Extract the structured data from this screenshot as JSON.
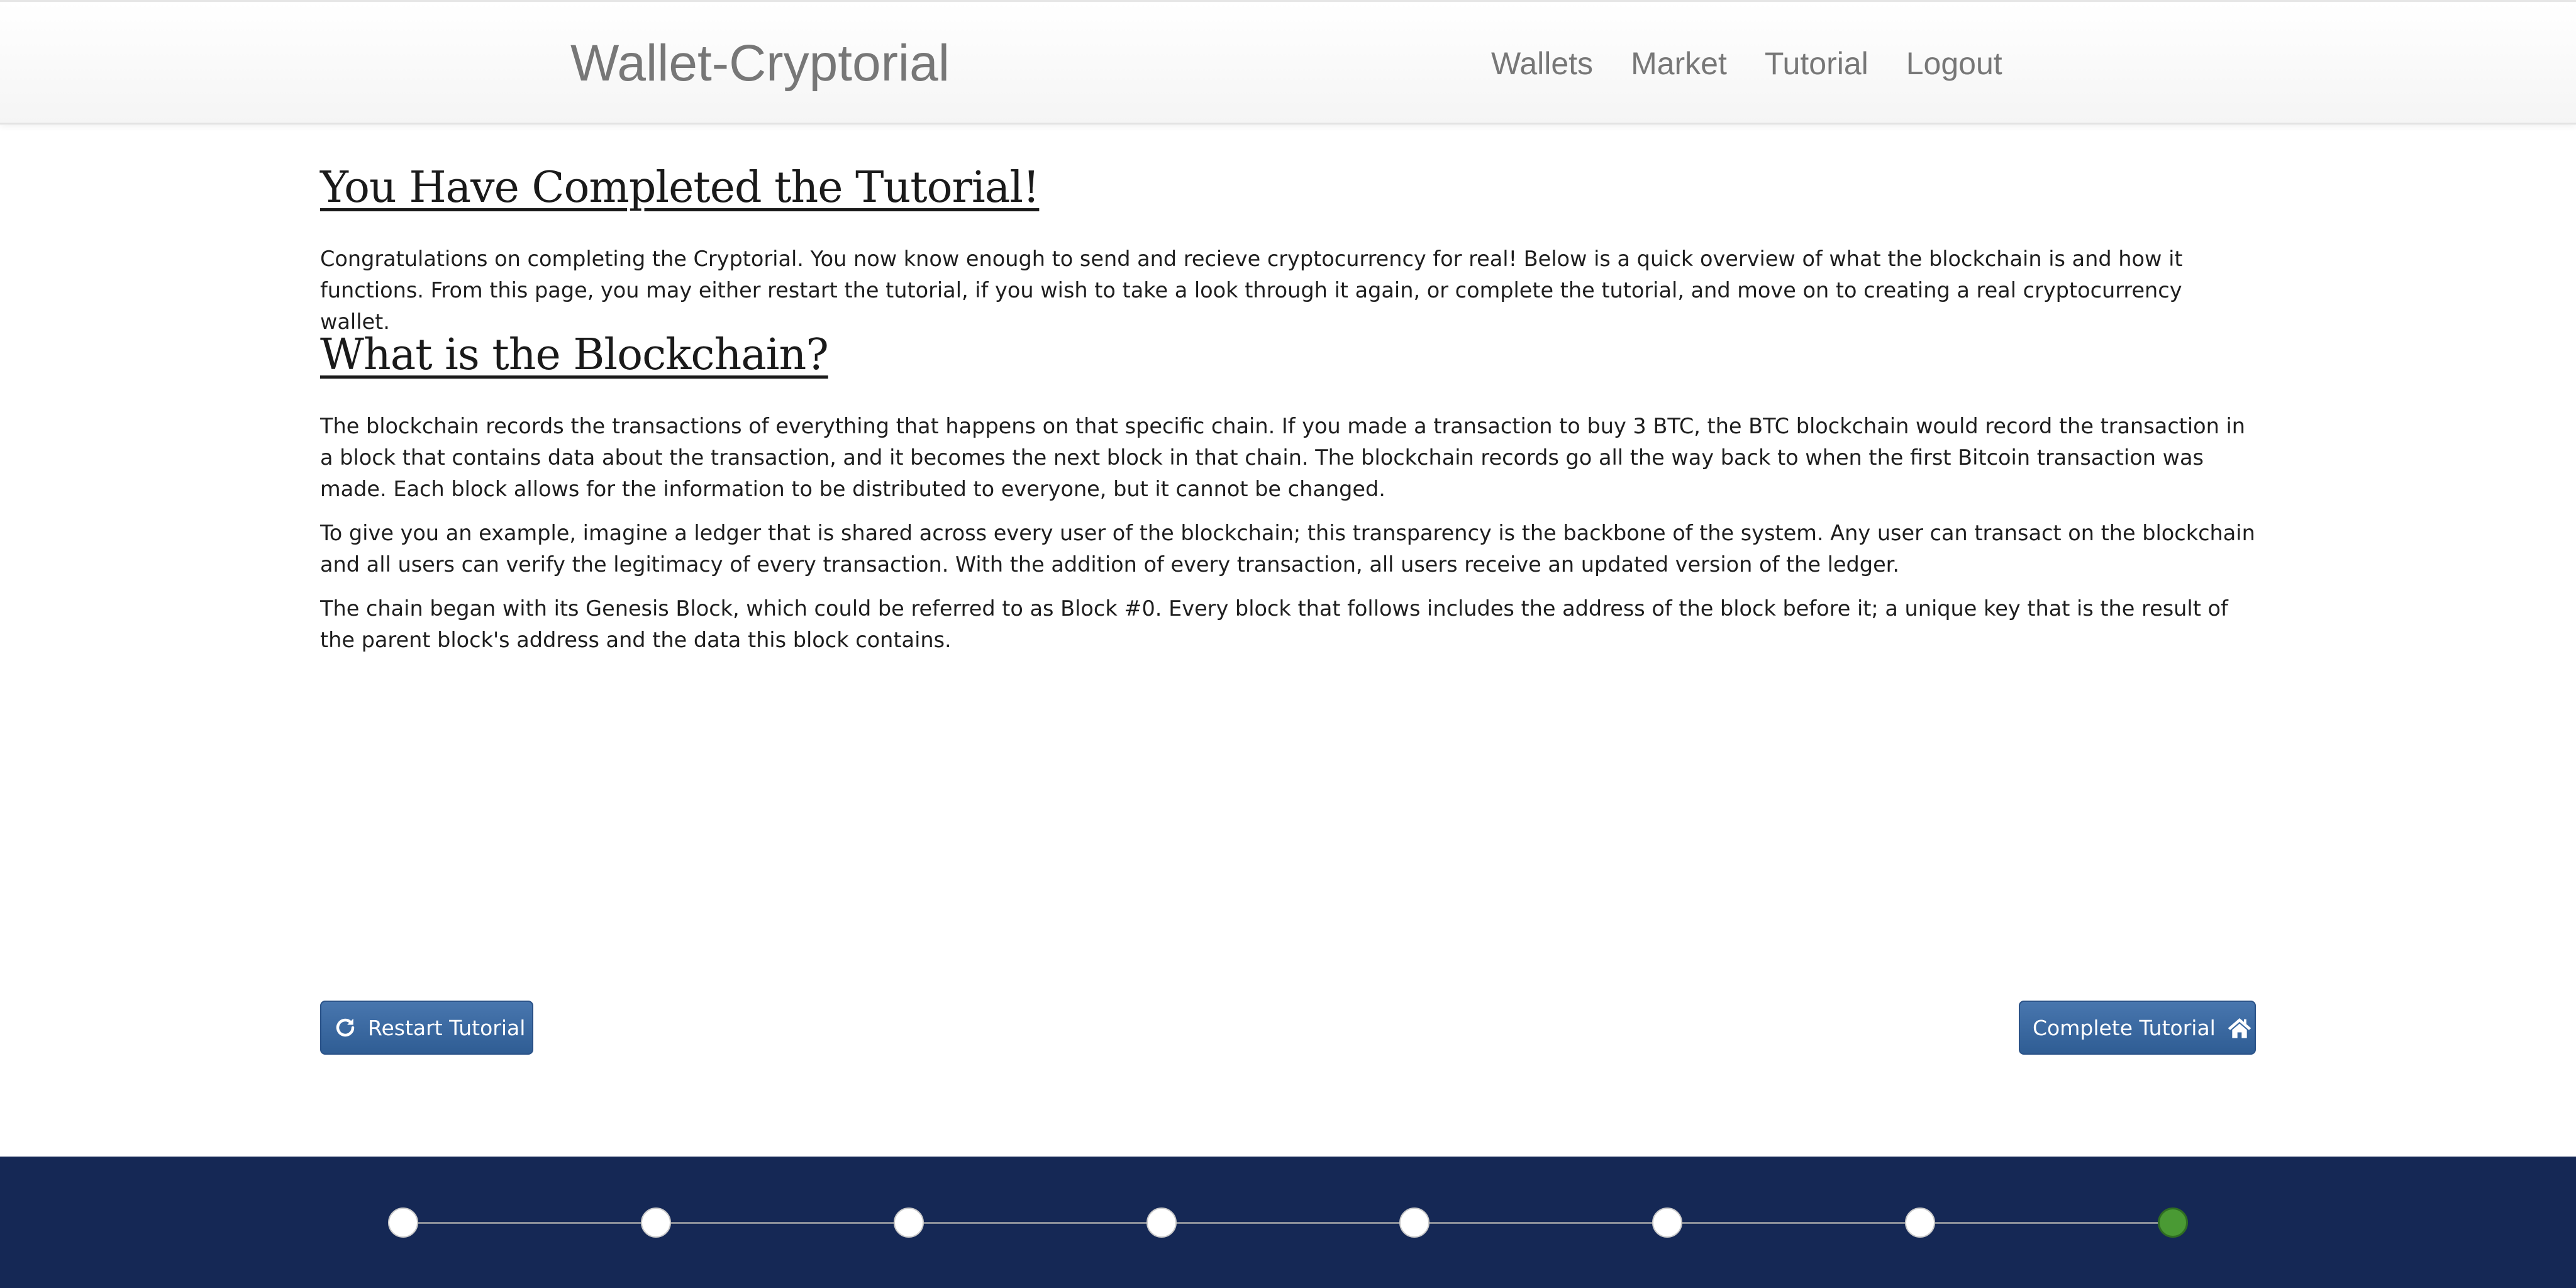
{
  "navbar": {
    "brand": "Wallet-Cryptorial",
    "links": [
      "Wallets",
      "Market",
      "Tutorial",
      "Logout"
    ]
  },
  "content": {
    "completed_title": "You Have Completed the Tutorial!",
    "completed_text": "Congratulations on completing the Cryptorial. You now know enough to send and recieve cryptocurrency for real! Below is a quick overview of what the blockchain is and how it functions. From this page, you may either restart the tutorial, if you wish to take a look through it again, or complete the tutorial, and move on to creating a real cryptocurrency wallet.",
    "blockchain_title": "What is the Blockchain?",
    "paragraphs": [
      "The blockchain records the transactions of everything that happens on that specific chain. If you made a transaction to buy 3 BTC, the BTC blockchain would record the transaction in a block that contains data about the transaction, and it becomes the next block in that chain. The blockchain records go all the way back to when the first Bitcoin transaction was made. Each block allows for the information to be distributed to everyone, but it cannot be changed.",
      "To give you an example, imagine a ledger that is shared across every user of the blockchain; this transparency is the backbone of the system. Any user can transact on the blockchain and all users can verify the legitimacy of every transaction. With the addition of every transaction, all users receive an updated version of the ledger.",
      "The chain began with its Genesis Block, which could be referred to as Block #0. Every block that follows includes the address of the block before it; a unique key that is the result of the parent block's address and the data this block contains."
    ]
  },
  "buttons": {
    "restart": {
      "label": "Restart Tutorial",
      "icon": "refresh-icon"
    },
    "complete": {
      "label": "Complete Tutorial",
      "icon": "home-icon"
    }
  },
  "progress": {
    "total_steps": 8,
    "current_step": 8,
    "colors": {
      "footer_bg": "#152855",
      "step_done": "#ffffff",
      "step_current": "#4a9a34"
    }
  },
  "colors": {
    "button_bg": "#3a679f",
    "nav_text": "#777777"
  }
}
